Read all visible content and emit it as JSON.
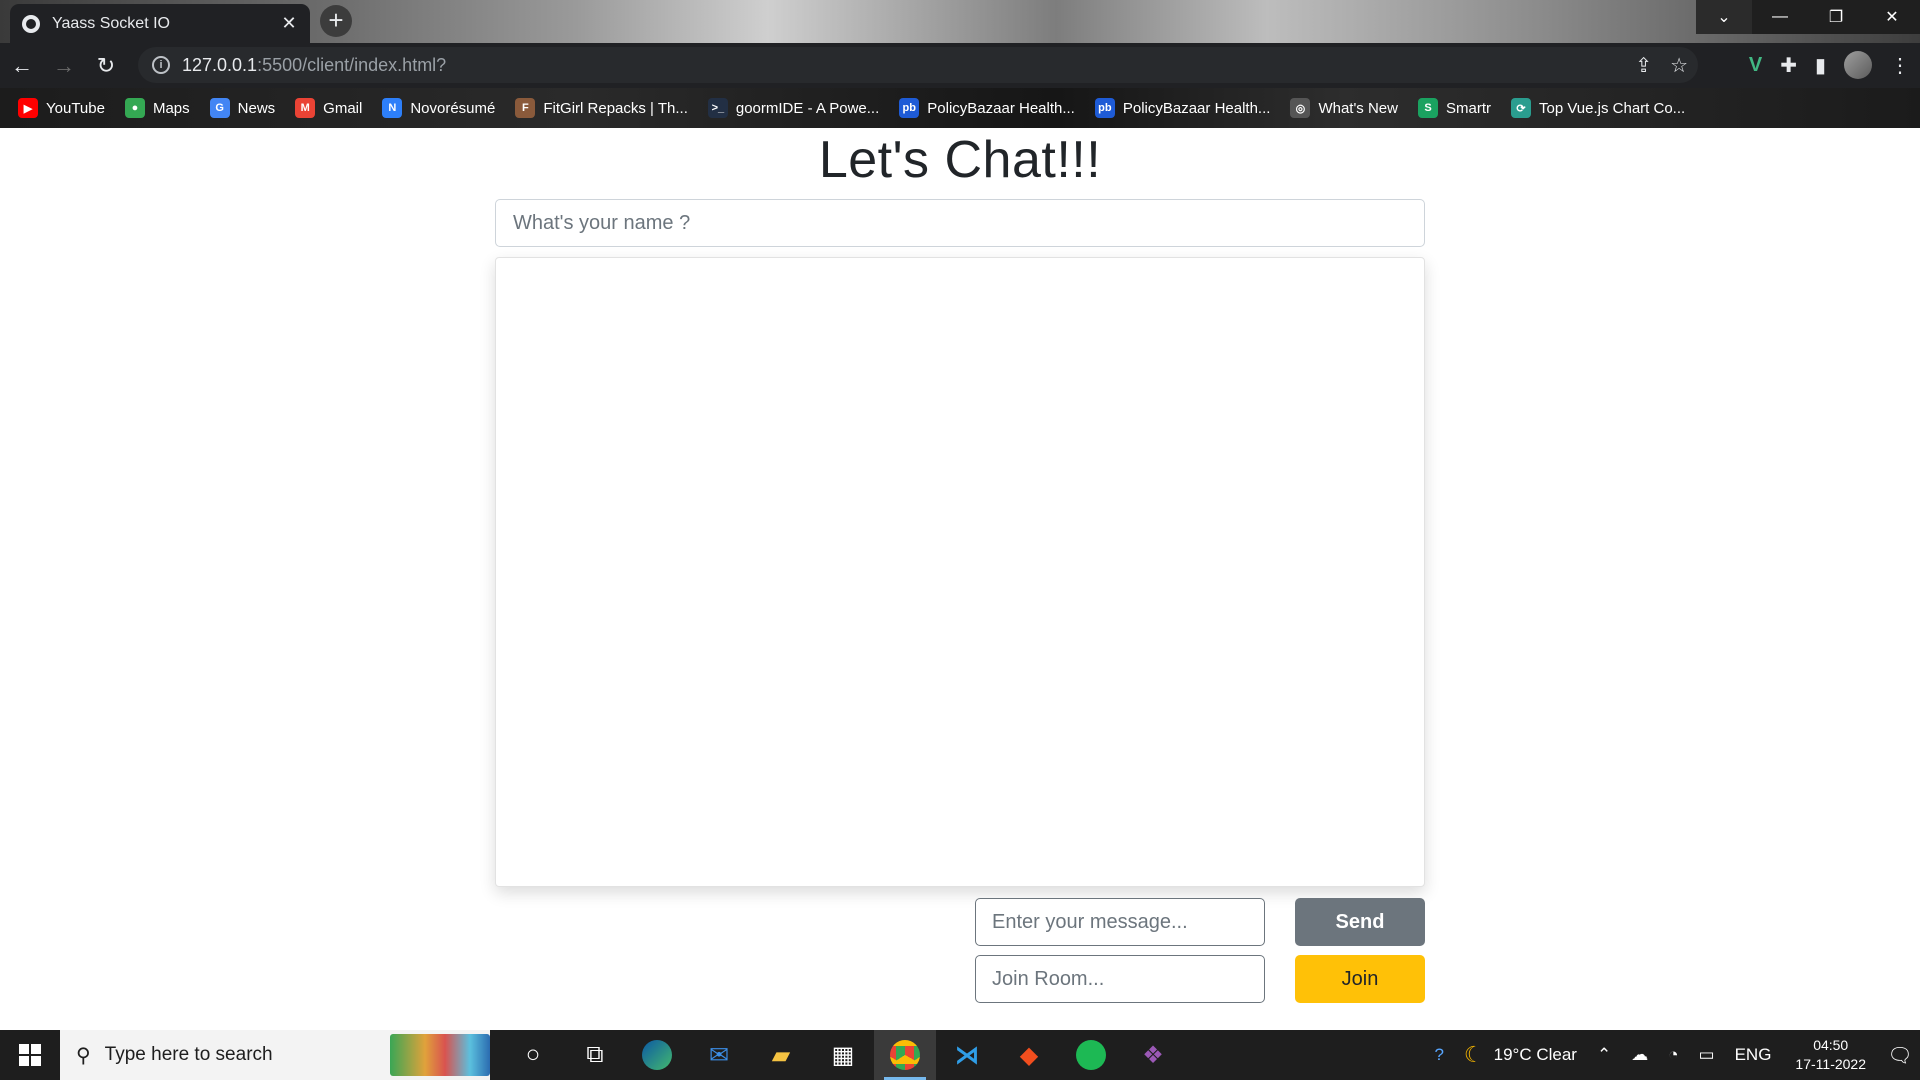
{
  "browser": {
    "tab_title": "Yaass Socket IO",
    "tab_close": "✕",
    "new_tab": "+",
    "url_host": "127.0.0.1",
    "url_path": ":5500/client/index.html?",
    "bookmarks": [
      {
        "label": "YouTube",
        "icon": "youtube-icon",
        "color": "#ff0000",
        "glyph": "▶"
      },
      {
        "label": "Maps",
        "icon": "maps-icon",
        "color": "#34a853",
        "glyph": "●"
      },
      {
        "label": "News",
        "icon": "news-icon",
        "color": "#4285f4",
        "glyph": "G"
      },
      {
        "label": "Gmail",
        "icon": "gmail-icon",
        "color": "#ea4335",
        "glyph": "M"
      },
      {
        "label": "Novorésumé",
        "icon": "novoresume-icon",
        "color": "#2d7ff9",
        "glyph": "N"
      },
      {
        "label": "FitGirl Repacks | Th...",
        "icon": "fitgirl-icon",
        "color": "#8a5a3b",
        "glyph": "F"
      },
      {
        "label": "goormIDE - A Powe...",
        "icon": "goorm-icon",
        "color": "#222f44",
        "glyph": ">_"
      },
      {
        "label": "PolicyBazaar Health...",
        "icon": "policybazaar-icon",
        "color": "#1e5bd6",
        "glyph": "pb"
      },
      {
        "label": "PolicyBazaar Health...",
        "icon": "policybazaar-icon",
        "color": "#1e5bd6",
        "glyph": "pb"
      },
      {
        "label": "What's New",
        "icon": "whatsnew-icon",
        "color": "#555555",
        "glyph": "◎"
      },
      {
        "label": "Smartr",
        "icon": "smartr-icon",
        "color": "#1aa260",
        "glyph": "S"
      },
      {
        "label": "Top Vue.js Chart Co...",
        "icon": "vue-chart-icon",
        "color": "#2a9d8f",
        "glyph": "⟳"
      }
    ]
  },
  "page": {
    "heading": "Let's Chat!!!",
    "name_placeholder": "What's your name ?",
    "message_placeholder": "Enter your message...",
    "room_placeholder": "Join Room...",
    "send_label": "Send",
    "join_label": "Join"
  },
  "taskbar": {
    "search_placeholder": "Type here to search",
    "weather": "19°C  Clear",
    "language": "ENG",
    "time": "04:50",
    "date": "17-11-2022"
  },
  "colors": {
    "send_button": "#6c757d",
    "join_button": "#ffc107",
    "browser_dark": "#202124"
  }
}
